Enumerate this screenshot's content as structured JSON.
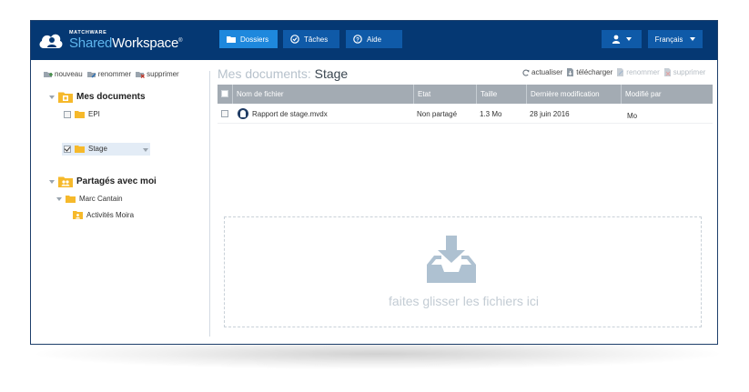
{
  "brand": {
    "small": "MATCHWARE",
    "shared": "Shared",
    "workspace": "Workspace",
    "mark": "®"
  },
  "nav": {
    "dossiers": "Dossiers",
    "taches": "Tâches",
    "aide": "Aide"
  },
  "language": "Français",
  "sidebar_toolbar": {
    "new": "nouveau",
    "rename": "renommer",
    "delete": "supprimer"
  },
  "tree": {
    "my_documents": "Mes documents",
    "epi": "EPI",
    "stage": "Stage",
    "shared_with_me": "Partagés avec moi",
    "marc_cantain": "Marc Cantain",
    "activites_moira": "Activités Moira"
  },
  "breadcrumb": {
    "root": "Mes documents:",
    "current": "Stage"
  },
  "actions": {
    "refresh": "actualiser",
    "download": "télécharger",
    "rename": "renommer",
    "delete": "supprimer"
  },
  "table": {
    "headers": [
      "Nom de fichier",
      "Etat",
      "Taille",
      "Dernière modification",
      "Modifié par"
    ],
    "rows": [
      {
        "name": "Rapport de stage.mvdx",
        "state": "Non partagé",
        "size": "1.3 Mo",
        "modified": "28 juin 2016",
        "by": "Mo"
      }
    ]
  },
  "dropzone": {
    "text": "faites glisser les fichiers ici"
  },
  "colors": {
    "topbar": "#053873",
    "active_nav": "#1e88dd",
    "button": "#0f5aa8",
    "folder": "#f6b92b",
    "header": "#a3abb3"
  }
}
